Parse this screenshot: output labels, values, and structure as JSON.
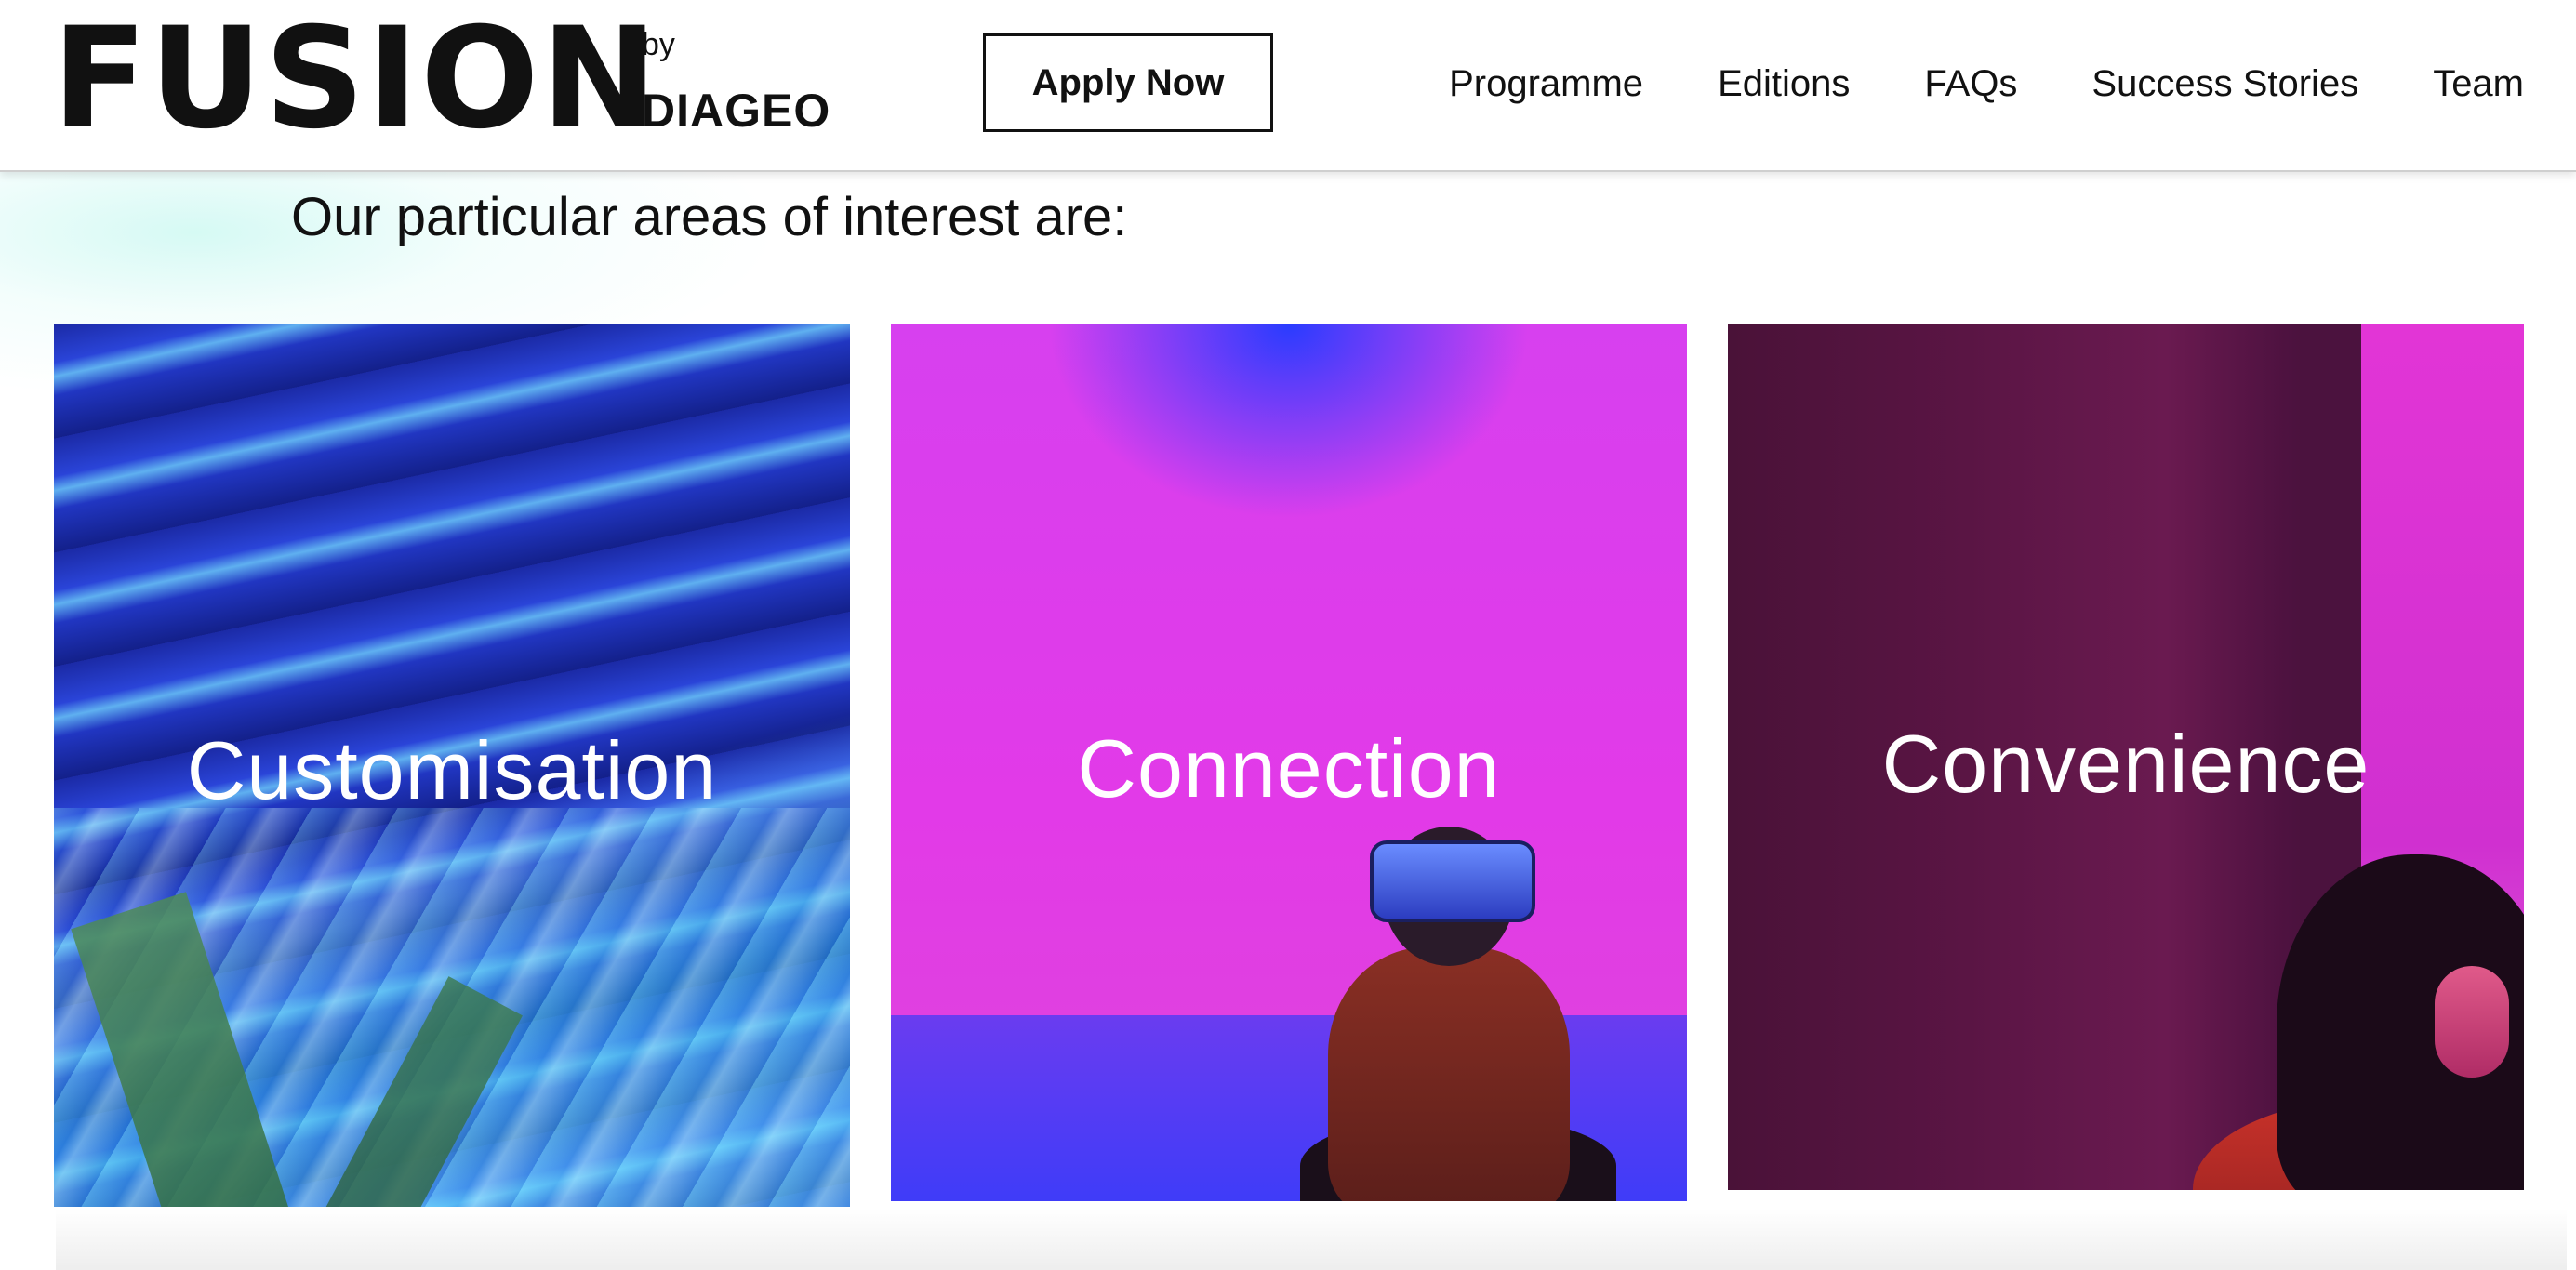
{
  "header": {
    "logo_text": "FUSION",
    "logo_by": "by",
    "logo_brand": "DIAGEO",
    "apply_label": "Apply Now",
    "nav": [
      {
        "label": "Programme"
      },
      {
        "label": "Editions"
      },
      {
        "label": "FAQs"
      },
      {
        "label": "Success Stories"
      },
      {
        "label": "Team"
      }
    ]
  },
  "main": {
    "intro": "Our particular areas of interest are:",
    "cards": [
      {
        "label": "Customisation",
        "palette": [
          "#1b2aa6",
          "#5fb0f0",
          "#2a5b3a"
        ]
      },
      {
        "label": "Connection",
        "palette": [
          "#e23ae8",
          "#2a3cff",
          "#3f3cf8"
        ]
      },
      {
        "label": "Convenience",
        "palette": [
          "#4a1238",
          "#e235d6",
          "#c9322a"
        ]
      }
    ]
  }
}
